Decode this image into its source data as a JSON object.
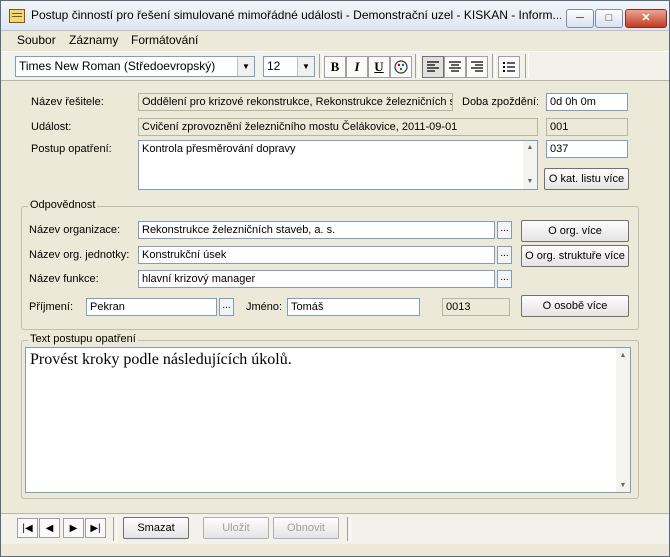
{
  "window": {
    "title": "Postup činností pro řešení simulované mimořádné události - Demonstrační uzel - KISKAN - Inform...",
    "minimize": "─",
    "maximize": "□",
    "close": "✕"
  },
  "menu": {
    "items": [
      "Soubor",
      "Záznamy",
      "Formátování"
    ]
  },
  "toolbar": {
    "font": "Times New Roman (Středoevropský)",
    "size": "12",
    "bold": "B",
    "italic": "I",
    "underline": "U",
    "align_left": "≡",
    "align_center": "≡",
    "align_right": "≡",
    "bullets": "☰"
  },
  "form": {
    "solver_label": "Název řešitele:",
    "solver_value": "Oddělení pro krizové rekonstrukce, Rekonstrukce železničních st",
    "delay_label": "Doba zpoždění:",
    "delay_value": "0d 0h 0m",
    "event_label": "Událost:",
    "event_value": "Cvičení zprovoznění železničního mostu Čelákovice, 2011-09-01",
    "event_code": "001",
    "procedure_label": "Postup opatření:",
    "procedure_value": "Kontrola přesměrování dopravy",
    "procedure_code": "037",
    "catalog_button": "O kat. listu více"
  },
  "responsibility": {
    "title": "Odpovědnost",
    "org_label": "Název organizace:",
    "org_value": "Rekonstrukce železničních staveb, a. s.",
    "org_button": "O org. více",
    "unit_label": "Název org. jednotky:",
    "unit_value": "Konstrukční úsek",
    "unit_button": "O org. struktuře více",
    "function_label": "Název funkce:",
    "function_value": "hlavní krizový manager",
    "surname_label": "Příjmení:",
    "surname_value": "Pekran",
    "name_label": "Jméno:",
    "name_value": "Tomáš",
    "person_code": "0013",
    "person_button": "O osobě více",
    "ellipsis": "..."
  },
  "text_section": {
    "title": "Text postupu opatření",
    "content": "Provést kroky podle následujících úkolů."
  },
  "bottom": {
    "first": "|◀",
    "prev": "◀",
    "next": "▶",
    "last": "▶|",
    "delete": "Smazat",
    "save": "Uložit",
    "renew": "Obnovit"
  }
}
